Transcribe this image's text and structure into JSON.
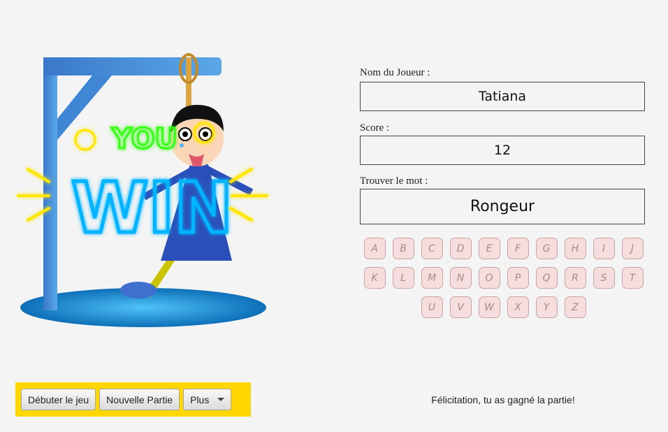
{
  "player": {
    "label": "Nom du Joueur :",
    "value": "Tatiana"
  },
  "score": {
    "label": "Score :",
    "value": "12"
  },
  "word": {
    "label": "Trouver le mot :",
    "value": "Rongeur"
  },
  "keyboard": {
    "rows": [
      [
        "A",
        "B",
        "C",
        "D",
        "E",
        "F",
        "G",
        "H",
        "I",
        "J"
      ],
      [
        "K",
        "L",
        "M",
        "N",
        "O",
        "P",
        "Q",
        "R",
        "S",
        "T"
      ],
      [
        "U",
        "V",
        "W",
        "X",
        "Y",
        "Z"
      ]
    ]
  },
  "toolbar": {
    "start_label": "Débuter le jeu",
    "new_game_label": "Nouvelle Partie",
    "more_label": "Plus"
  },
  "status": "Félicitation, tu as gagné la partie!",
  "win_art": {
    "text_you": "YOU",
    "text_win": "WIN"
  },
  "colors": {
    "toolbar_bg": "#ffd700",
    "key_bg": "#f7dede",
    "neon_blue": "#00b4ff",
    "neon_green": "#39ff14",
    "neon_yellow": "#ffe600"
  }
}
